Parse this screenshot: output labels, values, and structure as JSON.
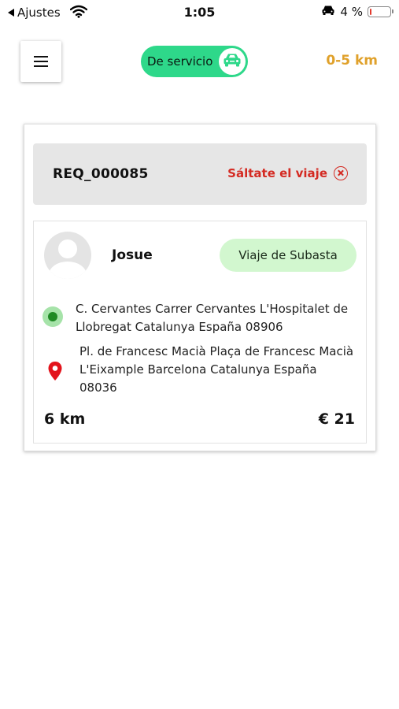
{
  "status_bar": {
    "back_label": "Ajustes",
    "time": "1:05",
    "battery_text": "4 %"
  },
  "header": {
    "service_label": "De servicio",
    "distance_range": "0-5 km"
  },
  "request": {
    "id": "REQ_000085",
    "skip_label": "Sáltate el viaje",
    "rider_name": "Josue",
    "trip_type": "Viaje de Subasta",
    "origin": "C. Cervantes Carrer Cervantes  L'Hospitalet de Llobregat Catalunya España 08906",
    "destination": "Pl. de Francesc Macià Plaça de Francesc Macià L'Eixample Barcelona Catalunya España 08036",
    "distance": "6 km",
    "price": "€ 21"
  },
  "colors": {
    "service_green": "#2ed88a",
    "range_orange": "#e0a12b",
    "skip_red": "#d42a22",
    "badge_green": "#d2f7cf",
    "origin_green": "#1f8a24",
    "pin_red": "#e3131b"
  },
  "icons": {
    "back": "back-triangle-icon",
    "wifi": "wifi-icon",
    "car_status": "car-icon",
    "battery": "battery-icon",
    "menu": "hamburger-menu-icon",
    "service_knob": "car-icon",
    "skip": "close-circle-icon",
    "avatar": "user-avatar-icon",
    "origin": "origin-dot-icon",
    "destination": "location-pin-icon"
  }
}
